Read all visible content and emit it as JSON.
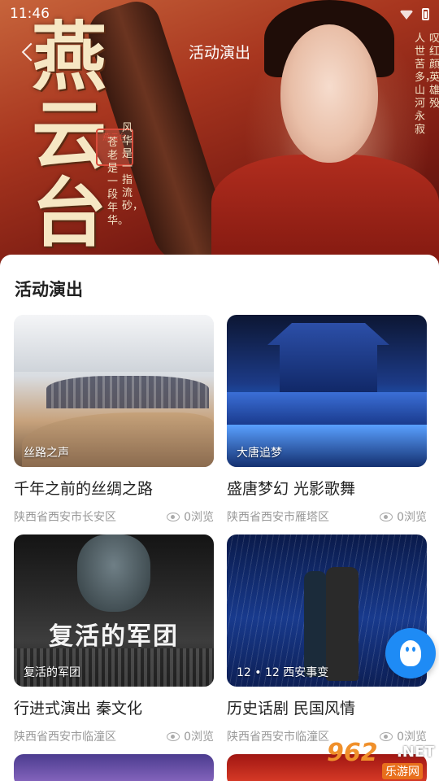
{
  "status_bar": {
    "time": "11:46"
  },
  "nav": {
    "title": "活动演出"
  },
  "hero": {
    "title_big": "燕云台",
    "poem_1": "风华是一指流砂，",
    "poem_2": "苍老是一段年华。",
    "poem_3": "叹红颜，英雄殁",
    "poem_4": "人世苦多，山河永寂",
    "seal": "燕云台"
  },
  "section": {
    "title": "活动演出"
  },
  "cards": [
    {
      "tag": "丝路之声",
      "title": "千年之前的丝绸之路",
      "location": "陕西省西安市长安区",
      "views": "0浏览"
    },
    {
      "tag": "大唐追梦",
      "title": "盛唐梦幻 光影歌舞",
      "location": "陕西省西安市雁塔区",
      "views": "0浏览"
    },
    {
      "tag": "复活的军团",
      "title": "行进式演出 秦文化",
      "location": "陕西省西安市临潼区",
      "views": "0浏览",
      "thumb_text": "复活的军团"
    },
    {
      "tag": "12 • 12 西安事变",
      "title": "历史话剧 民国风情",
      "location": "陕西省西安市临潼区",
      "views": "0浏览"
    }
  ],
  "watermark": {
    "number": "962",
    "domain": ".NET",
    "site": "乐游网"
  },
  "colors": {
    "accent": "#1e8bf5",
    "text": "#222222",
    "muted": "#999999"
  }
}
